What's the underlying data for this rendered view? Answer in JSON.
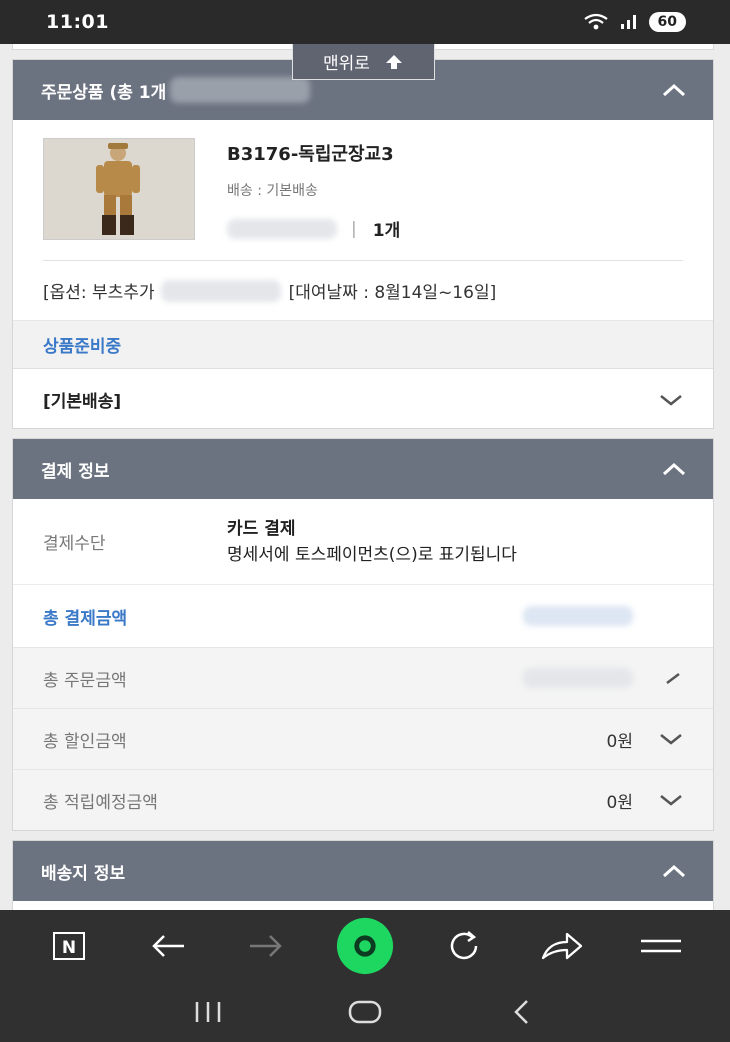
{
  "status": {
    "time": "11:01",
    "battery": "60"
  },
  "back_to_top": "맨위로",
  "order_section": {
    "title": "주문상품 (총 1개",
    "product": {
      "name": "B3176-독립군장교3",
      "shipping": "배송 : 기본배송",
      "qty_label": "1개",
      "option_prefix": "[옵션: 부츠추가",
      "rental_period": "[대여날짜 : 8월14일~16일]"
    },
    "status_label": "상품준비중",
    "delivery_label": "[기본배송]"
  },
  "payment_section": {
    "title": "결제 정보",
    "method_label": "결제수단",
    "method_value": "카드 결제",
    "method_note": "명세서에 토스페이먼츠(으)로 표기됩니다",
    "total_label": "총 결제금액",
    "order_total_label": "총 주문금액",
    "discount_label": "총 할인금액",
    "discount_value": "0원",
    "points_label": "총 적립예정금액",
    "points_value": "0원"
  },
  "shipping_section": {
    "title": "배송지 정보"
  },
  "browser": {
    "icons": [
      "naver-n-icon",
      "back-arrow-icon",
      "forward-arrow-icon",
      "green-home-icon",
      "refresh-icon",
      "share-icon",
      "menu-icon"
    ]
  },
  "nav": {
    "icons": [
      "recent-apps-icon",
      "home-icon",
      "back-icon"
    ]
  },
  "colors": {
    "header": "#6c7380",
    "link_blue": "#3a78c8",
    "green": "#1ed760"
  }
}
